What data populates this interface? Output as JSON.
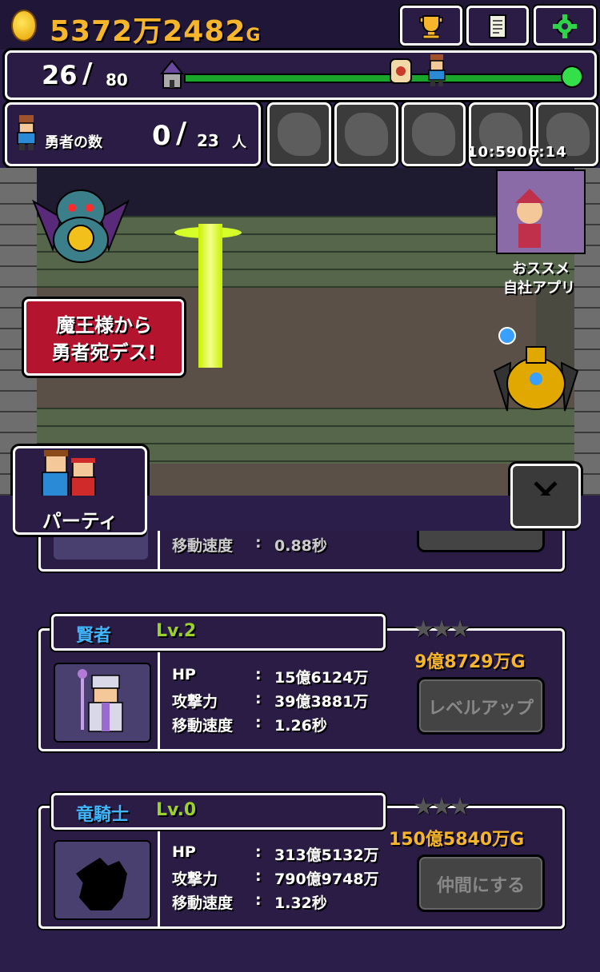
{
  "header": {
    "gold_amount": "5372万2482",
    "gold_unit": "G",
    "buttons": [
      "trophy-icon",
      "document-icon",
      "gear-icon"
    ]
  },
  "progress": {
    "current": "26",
    "slash": "/",
    "max": "80",
    "fraction": 0.325
  },
  "heroes": {
    "label": "勇者の数",
    "current": "0",
    "slash": "/",
    "max": "23",
    "unit": "人"
  },
  "timer": "10:5906:14",
  "banner": {
    "line1": "魔王様から",
    "line2": "勇者宛デス!"
  },
  "promo": {
    "line1": "おススメ",
    "line2": "自社アプリ"
  },
  "party": {
    "label": "パーティ"
  },
  "partial_card": {
    "stat_label": "移動速度",
    "stat_colon": ":",
    "stat_value": "0.88秒"
  },
  "cards": [
    {
      "name": "賢者",
      "level": "Lv.2",
      "stats": [
        {
          "label": "HP",
          "colon": ":",
          "value": "15億6124万"
        },
        {
          "label": "攻撃力",
          "colon": ":",
          "value": "39億3881万"
        },
        {
          "label": "移動速度",
          "colon": ":",
          "value": "1.26秒"
        }
      ],
      "cost": "9億8729万G",
      "action": "レベルアップ",
      "stars": "★★★"
    },
    {
      "name": "竜騎士",
      "level": "Lv.0",
      "stats": [
        {
          "label": "HP",
          "colon": ":",
          "value": "313億5132万"
        },
        {
          "label": "攻撃力",
          "colon": ":",
          "value": "790億9748万"
        },
        {
          "label": "移動速度",
          "colon": ":",
          "value": "1.32秒"
        }
      ],
      "cost": "150億5840万G",
      "action": "仲間にする",
      "stars": "★★★"
    }
  ],
  "colors": {
    "accent_gold": "#f6b52a",
    "name_blue": "#3fb6ff",
    "level_green": "#9bd12c",
    "banner_red": "#b5142e"
  }
}
